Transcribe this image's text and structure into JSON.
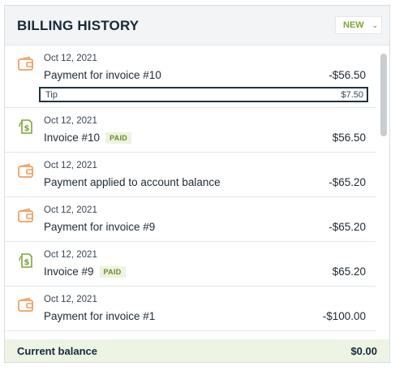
{
  "header": {
    "title": "BILLING HISTORY",
    "new_label": "NEW"
  },
  "colors": {
    "accent": "#7fa43a",
    "wallet_icon": "#f0a060",
    "invoice_icon": "#7fa43a",
    "dark": "#142a38"
  },
  "transactions": [
    {
      "icon": "wallet-icon",
      "date": "Oct 12, 2021",
      "description": "Payment for invoice #10",
      "amount": "-$56.50",
      "tip": {
        "label": "Tip",
        "amount": "$7.50"
      }
    },
    {
      "icon": "invoice-dollar-icon",
      "date": "Oct 12, 2021",
      "description": "Invoice #10",
      "badge": "PAID",
      "amount": "$56.50"
    },
    {
      "icon": "wallet-icon",
      "date": "Oct 12, 2021",
      "description": "Payment applied to account balance",
      "amount": "-$65.20"
    },
    {
      "icon": "wallet-icon",
      "date": "Oct 12, 2021",
      "description": "Payment for invoice #9",
      "amount": "-$65.20"
    },
    {
      "icon": "invoice-dollar-icon",
      "date": "Oct 12, 2021",
      "description": "Invoice #9",
      "badge": "PAID",
      "amount": "$65.20"
    },
    {
      "icon": "wallet-icon",
      "date": "Oct 12, 2021",
      "description": "Payment for invoice #1",
      "amount": "-$100.00"
    }
  ],
  "footer": {
    "label": "Current balance",
    "value": "$0.00"
  }
}
